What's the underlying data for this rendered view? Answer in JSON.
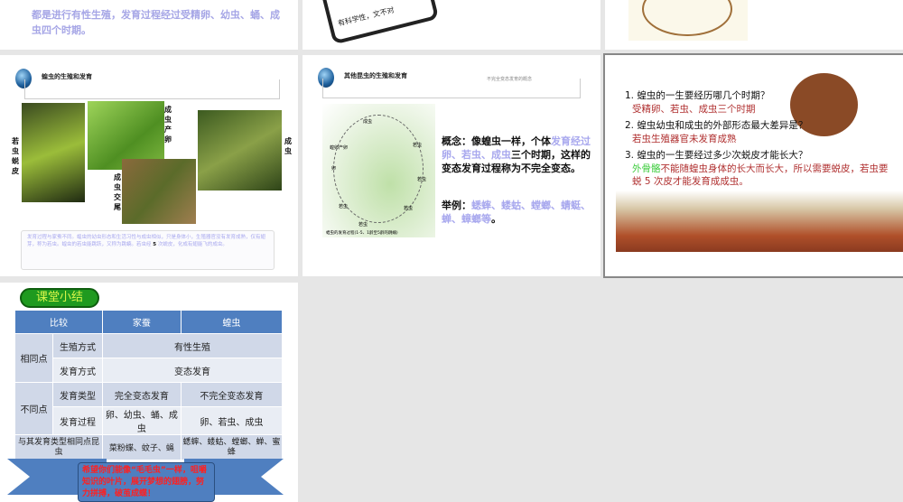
{
  "slide1": {
    "text": "都是进行有性生殖，发育过程经过受精卵、幼虫、蛹、成虫四个时期。"
  },
  "slide2": {
    "text": "有科学性，文不对"
  },
  "slide4": {
    "title": "蝗虫的生殖和发育",
    "labels": [
      "若虫蜕皮",
      "成虫产卵",
      "成虫交尾",
      "成虫"
    ],
    "note_a": "发育过程与家蚕不同。蝗虫的幼虫形态和生活习性与成虫相似，只是身体小，生殖器官没有发育成熟，仅有翅芽，称为若虫。蝗虫的若虫能跳跃，又称为跳蝻。若虫经 ",
    "note_num": "5",
    "note_b": " 次蜕皮，化成有翅能飞的成虫。"
  },
  "slide5": {
    "title": "其他昆虫的生殖和发育",
    "subtitle": "不完全变态发育的概念",
    "diagram_caption": "蝗虫的发育过程(1-5、1龄至5龄的跳蝻)",
    "diagram_labels": [
      "成虫",
      "若虫",
      "若虫",
      "若虫",
      "若虫",
      "若虫",
      "蝗卵产卵",
      "卵"
    ],
    "concept_a": "概念：像蝗虫一样，个体",
    "concept_hl": "发育经过卵、若虫、成虫",
    "concept_b": "三个时期，这样的变态发育过程称为不完全变态。",
    "example_label": "举例：",
    "example_hl": "蟋蟀、蝼蛄、螳螂、蜻蜓、蝉、蟑螂等",
    "example_end": "。"
  },
  "slide6": {
    "q1": "1. 蝗虫的一生要经历哪几个时期？",
    "a1": "受精卵、若虫、成虫三个时期",
    "q2": "2. 蝗虫幼虫和成虫的外部形态最大差异是？",
    "a2": "若虫生殖器官未发育成熟",
    "q3": "3. 蝗虫的一生要经过多少次蜕皮才能长大？",
    "a3_green": "外骨骼",
    "a3": "不能随蝗虫身体的长大而长大，所以需要蜕皮，若虫要蜕 5 次皮才能发育成成虫。"
  },
  "slide7": {
    "badge": "课堂小结",
    "header": [
      "比较",
      "家蚕",
      "蝗虫"
    ],
    "same_label": "相同点",
    "diff_label": "不同点",
    "rows": {
      "r1": {
        "label": "生殖方式",
        "value": "有性生殖"
      },
      "r2": {
        "label": "发育方式",
        "value": "变态发育"
      },
      "r3": {
        "label": "发育类型",
        "silkworm": "完全变态发育",
        "locust": "不完全变态发育"
      },
      "r4": {
        "label": "发育过程",
        "silkworm": "卵、幼虫、蛹、成虫",
        "locust": "卵、若虫、成虫"
      },
      "r5": {
        "label": "与其发育类型相同点昆虫",
        "silkworm": "菜粉蝶、蚊子、蝇",
        "locust": "蟋蟀、蝼蛄、螳螂、蝉、蜜蜂"
      }
    },
    "banner": "希望你们能像“毛毛虫”一样，咀嚼知识的叶片，展开梦想的翅膀，努力拼搏，破茧成蝶！"
  }
}
